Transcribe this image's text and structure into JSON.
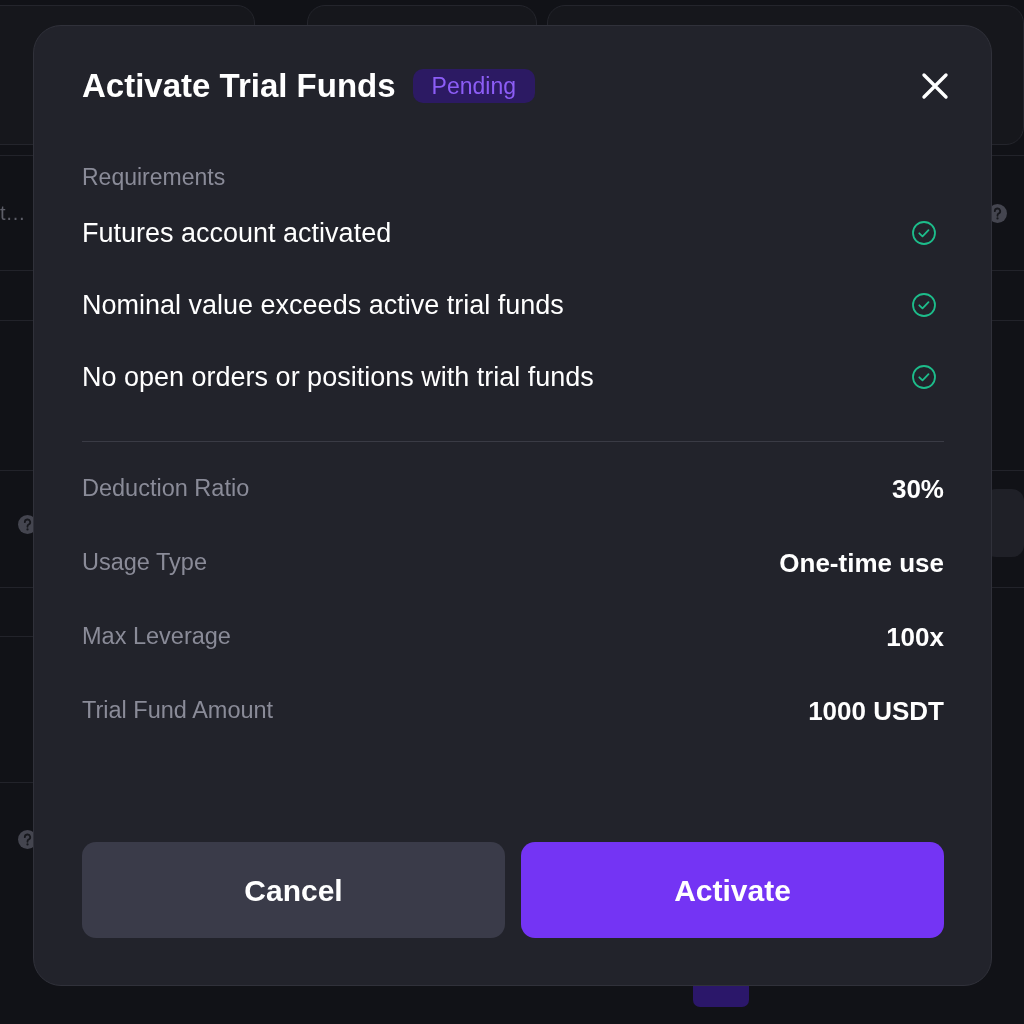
{
  "background_page": {
    "truncated_text": "t…"
  },
  "dialog": {
    "title": "Activate Trial Funds",
    "status_badge": "Pending",
    "requirements_heading": "Requirements",
    "requirements": [
      {
        "label": "Futures account activated",
        "met": true
      },
      {
        "label": "Nominal value exceeds active trial funds",
        "met": true
      },
      {
        "label": "No open orders or positions with trial funds",
        "met": true
      }
    ],
    "details": [
      {
        "label": "Deduction Ratio",
        "value": "30%"
      },
      {
        "label": "Usage Type",
        "value": "One-time use"
      },
      {
        "label": "Max Leverage",
        "value": "100x"
      },
      {
        "label": "Trial Fund Amount",
        "value": "1000 USDT"
      }
    ],
    "buttons": [
      {
        "label": "Cancel",
        "kind": "secondary"
      },
      {
        "label": "Activate",
        "kind": "primary"
      }
    ]
  }
}
